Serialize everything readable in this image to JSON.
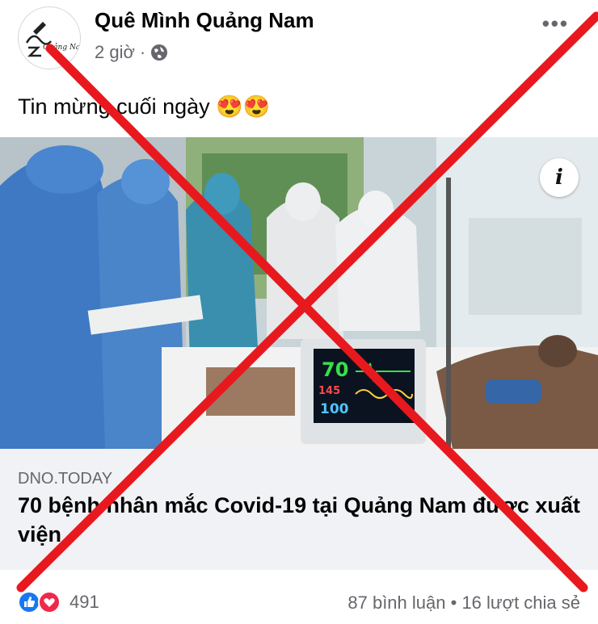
{
  "post": {
    "page_name": "Quê Mình Quảng Nam",
    "time": "2 giờ",
    "separator": "·",
    "audience_icon": "globe-icon",
    "more_icon": "more-options-icon",
    "more_label": "•••",
    "text": "Tin mừng cuối ngày 😍😍",
    "avatar_logo_text": "Quảng Nam"
  },
  "link_preview": {
    "domain": "DNO.TODAY",
    "headline": "70 bệnh nhân mắc Covid-19 tại Quảng Nam được xuất viện",
    "info_label": "i",
    "monitor_hr": "70",
    "monitor_bp": "145",
    "monitor_spo2": "100"
  },
  "footer": {
    "reaction_icons": [
      "like-icon",
      "love-icon"
    ],
    "reaction_count": "491",
    "comments": "87 bình luận",
    "dot": "•",
    "shares": "16 lượt chia sẻ"
  },
  "overlay": {
    "color": "#e8191e"
  }
}
